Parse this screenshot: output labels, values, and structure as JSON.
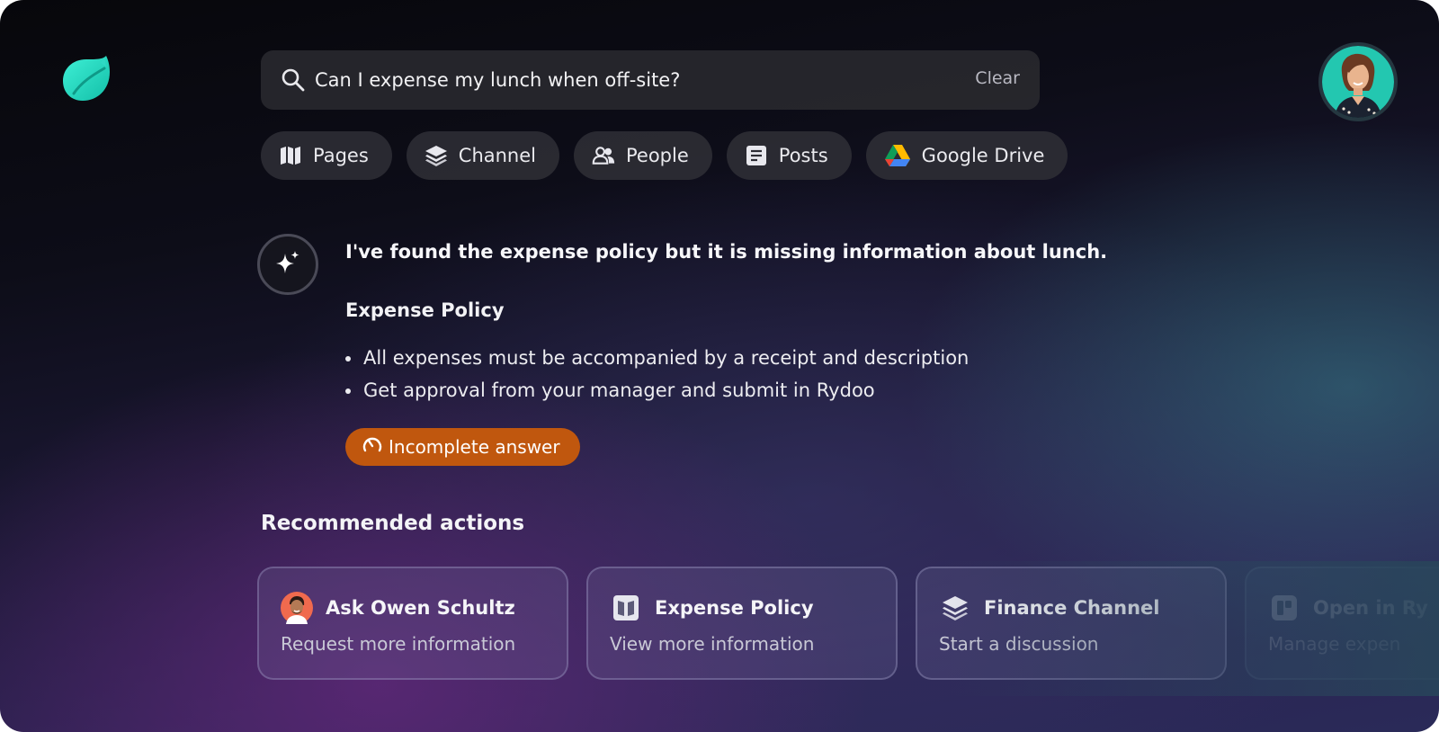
{
  "colors": {
    "logo_accent": "#2fd9c4",
    "badge_bg": "#c0570e",
    "search_bg": "#28282e"
  },
  "search": {
    "query": "Can I expense my lunch when off-site?",
    "clear_label": "Clear",
    "icon": "search-icon"
  },
  "filters": [
    {
      "label": "Pages",
      "icon": "book-icon"
    },
    {
      "label": "Channel",
      "icon": "layers-icon"
    },
    {
      "label": "People",
      "icon": "people-icon"
    },
    {
      "label": "Posts",
      "icon": "document-icon"
    },
    {
      "label": "Google Drive",
      "icon": "google-drive-icon"
    }
  ],
  "answer": {
    "icon": "sparkle-icon",
    "headline": "I've found the expense policy but it is missing information about lunch.",
    "policy_title": "Expense Policy",
    "bullets": [
      "All expenses must be accompanied by a receipt and description",
      "Get approval from your manager and submit in Rydoo"
    ],
    "status_badge": "Incomplete answer"
  },
  "recommended": {
    "title": "Recommended actions",
    "cards": [
      {
        "title": "Ask Owen Schultz",
        "subtitle": "Request more information",
        "icon": "person-avatar-icon"
      },
      {
        "title": "Expense Policy",
        "subtitle": "View more information",
        "icon": "book-icon"
      },
      {
        "title": "Finance Channel",
        "subtitle": "Start a discussion",
        "icon": "layers-icon"
      },
      {
        "title": "Open in Ry",
        "subtitle": "Manage expen",
        "icon": "rydoo-app-icon"
      }
    ]
  }
}
